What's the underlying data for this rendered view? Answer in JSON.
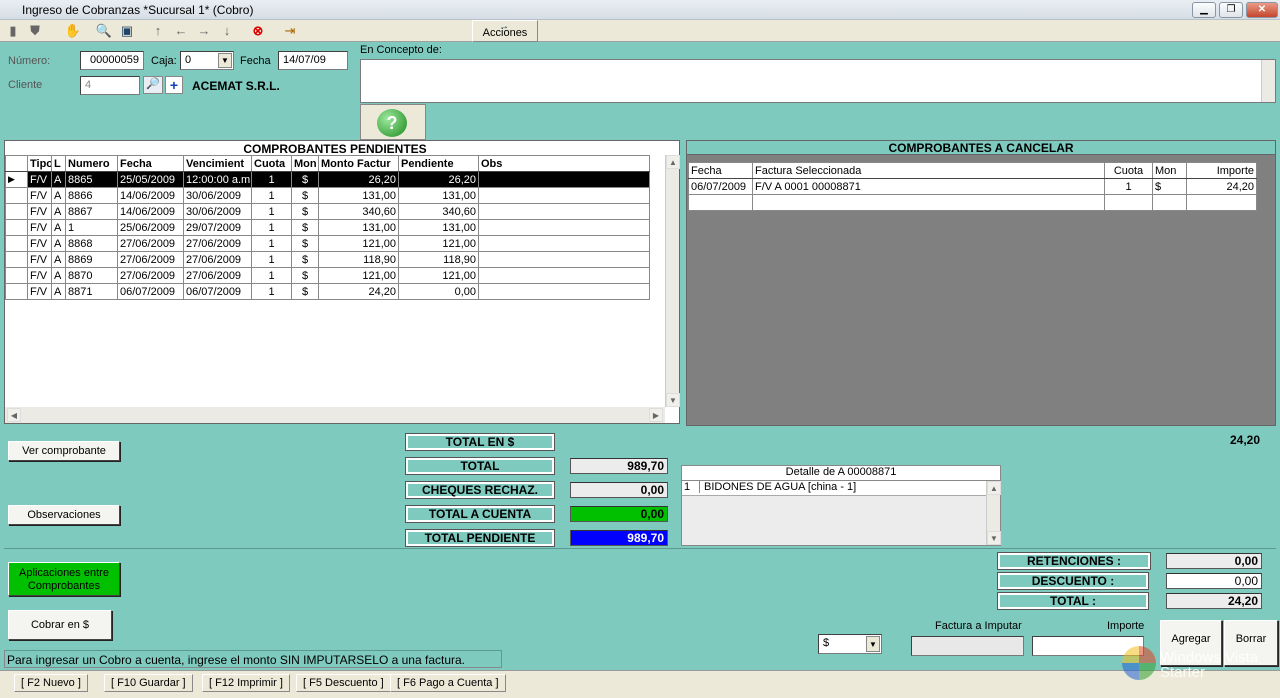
{
  "window": {
    "title": "Ingreso de Cobranzas *Sucursal 1* (Cobro)"
  },
  "toolbar": {
    "acciones": "Acciones"
  },
  "form": {
    "numero_label": "Número:",
    "numero": "00000059",
    "caja_label": "Caja:",
    "caja": "0",
    "fecha_label": "Fecha",
    "fecha": "14/07/09",
    "cliente_label": "Cliente",
    "cliente_id": "4",
    "cliente_nombre": "ACEMAT S.R.L.",
    "concepto_label": "En Concepto de:",
    "concepto": ""
  },
  "pendientes": {
    "title": "COMPROBANTES PENDIENTES",
    "columns": [
      "Tipo",
      "L",
      "Numero",
      "Fecha",
      "Vencimient",
      "Cuota",
      "Mon",
      "Monto Factur",
      "Pendiente",
      "Obs"
    ],
    "rows": [
      [
        "F/V",
        "A",
        "8865",
        "25/05/2009",
        "12:00:00 a.m.",
        "1",
        "$",
        "26,20",
        "26,20",
        ""
      ],
      [
        "F/V",
        "A",
        "8866",
        "14/06/2009",
        "30/06/2009",
        "1",
        "$",
        "131,00",
        "131,00",
        ""
      ],
      [
        "F/V",
        "A",
        "8867",
        "14/06/2009",
        "30/06/2009",
        "1",
        "$",
        "340,60",
        "340,60",
        ""
      ],
      [
        "F/V",
        "A",
        "1",
        "25/06/2009",
        "29/07/2009",
        "1",
        "$",
        "131,00",
        "131,00",
        ""
      ],
      [
        "F/V",
        "A",
        "8868",
        "27/06/2009",
        "27/06/2009",
        "1",
        "$",
        "121,00",
        "121,00",
        ""
      ],
      [
        "F/V",
        "A",
        "8869",
        "27/06/2009",
        "27/06/2009",
        "1",
        "$",
        "118,90",
        "118,90",
        ""
      ],
      [
        "F/V",
        "A",
        "8870",
        "27/06/2009",
        "27/06/2009",
        "1",
        "$",
        "121,00",
        "121,00",
        ""
      ],
      [
        "F/V",
        "A",
        "8871",
        "06/07/2009",
        "06/07/2009",
        "1",
        "$",
        "24,20",
        "0,00",
        ""
      ]
    ]
  },
  "cancelar": {
    "title": "COMPROBANTES A CANCELAR",
    "columns": [
      "Fecha",
      "Factura Seleccionada",
      "Cuota",
      "Mon",
      "Importe"
    ],
    "rows": [
      [
        "06/07/2009",
        "F/V A 0001 00008871",
        "1",
        "$",
        "24,20"
      ]
    ],
    "total": "24,20"
  },
  "buttons": {
    "ver_comprobante": "Ver comprobante",
    "observaciones": "Observaciones",
    "aplicaciones": "Aplicaciones entre Comprobantes",
    "cobrar": "Cobrar en $",
    "agregar": "Agregar",
    "borrar": "Borrar"
  },
  "totales": {
    "total_en": "TOTAL EN $",
    "total_label": "TOTAL",
    "total": "989,70",
    "cheques_label": "CHEQUES RECHAZ.",
    "cheques": "0,00",
    "a_cuenta_label": "TOTAL A CUENTA",
    "a_cuenta": "0,00",
    "pendiente_label": "TOTAL PENDIENTE",
    "pendiente": "989,70"
  },
  "detalle": {
    "title": "Detalle de A 00008871",
    "rows": [
      [
        "1",
        "BIDONES DE AGUA [china - 1]"
      ]
    ]
  },
  "resumen": {
    "retenciones_label": "RETENCIONES :",
    "retenciones": "0,00",
    "descuento_label": "DESCUENTO :",
    "descuento": "0,00",
    "total_label": "TOTAL :",
    "total": "24,20"
  },
  "imputar": {
    "moneda": "$",
    "factura_label": "Factura a Imputar",
    "importe_label": "Importe",
    "factura": "",
    "importe": ""
  },
  "hint": "Para ingresar un Cobro a cuenta, ingrese el monto SIN IMPUTARSELO a una factura.",
  "fkeys": [
    "[ F2 Nuevo ]",
    "[ F10 Guardar ]",
    "[ F12 Imprimir ]",
    "[ F5 Descuento ]",
    "[ F6 Pago a Cuenta ]"
  ],
  "watermark": {
    "line1": "Windows Vista",
    "line2": "Starter"
  },
  "colors": {
    "background": "#7fcabf",
    "a_cuenta": "#00c000",
    "pendiente": "#0000ff",
    "aplicaciones": "#00c000"
  }
}
